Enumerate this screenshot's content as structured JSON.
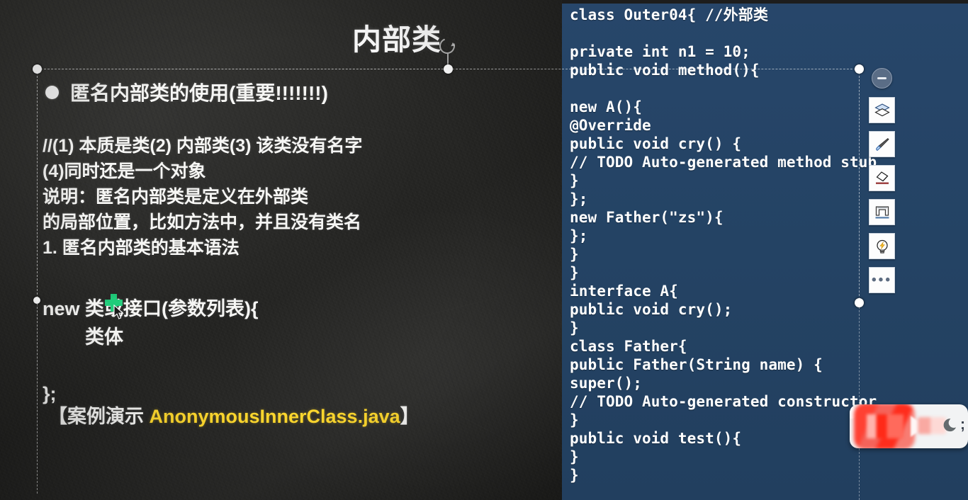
{
  "slide": {
    "title": "内部类",
    "heading": "匿名内部类的使用(重要!!!!!!!)",
    "body_lines": "//(1) 本质是类(2) 内部类(3) 该类没有名字\n(4)同时还是一个对象\n说明：匿名内部类是定义在外部类\n的局部位置，比如方法中，并且没有类名\n1. 匿名内部类的基本语法",
    "syntax_lines": "new 类或接口(参数列表){\n        类体\n\n};",
    "demo_prefix": "【案例演示 ",
    "demo_filename": "AnonymousInnerClass.java",
    "demo_suffix": "】",
    "colors": {
      "board_bg": "#2a2a28",
      "chalk_text": "#f6f6f4",
      "filename_highlight": "#ffd92e",
      "green_mark": "#1fcd7a"
    }
  },
  "code_panel": {
    "background_color": "#274669",
    "text_color": "#ffffff",
    "source": "class Outer04{ //外部类\n\nprivate int n1 = 10;\npublic void method(){\n\nnew A(){\n@Override\npublic void cry() {\n// TODO Auto-generated method stub\n}\n};\nnew Father(\"zs\"){\n};\n}\n}\ninterface A{\npublic void cry();\n}\nclass Father{\npublic Father(String name) {\nsuper();\n// TODO Auto-generated constructor\n}\npublic void test(){\n}\n}"
  },
  "toolbar": {
    "collapse_label": "collapse",
    "items": [
      {
        "icon": "layers-icon",
        "label": "Layers"
      },
      {
        "icon": "brush-icon",
        "label": "Pen"
      },
      {
        "icon": "eraser-icon",
        "label": "Eraser"
      },
      {
        "icon": "shape-icon",
        "label": "Shape"
      },
      {
        "icon": "lightbulb-icon",
        "label": "Ideas"
      },
      {
        "icon": "more-icon",
        "label": "..."
      }
    ],
    "more_glyph": "•••"
  },
  "overlay": {
    "semicolon": ";",
    "moon_icon": "moon-icon",
    "logo_icon": "recording-logo-icon"
  },
  "selection": {
    "title_handle": "rotate-handle",
    "handles_count": 4
  }
}
